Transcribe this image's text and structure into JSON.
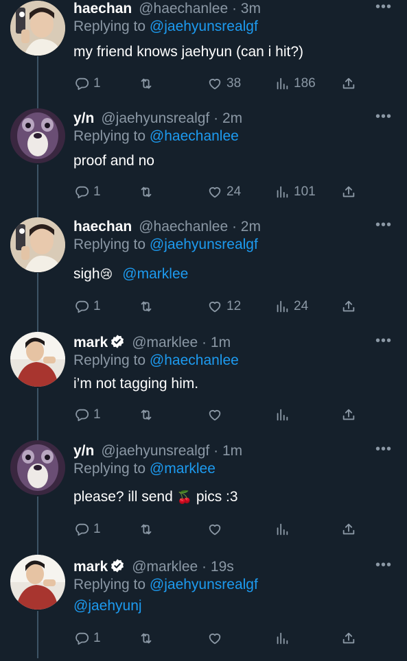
{
  "tweets": [
    {
      "name": "haechan",
      "verified": false,
      "handle": "@haechanlee",
      "time": "3m",
      "replying_prefix": "Replying to",
      "replying_to": "@jaehyunsrealgf",
      "text": "my friend knows jaehyun (can i hit?)",
      "mention": "",
      "emoji": "",
      "text_after": "",
      "replies": "1",
      "retweets": "",
      "likes": "38",
      "views": "186",
      "avatar": "haechan-selfie"
    },
    {
      "name": "y/n",
      "verified": false,
      "handle": "@jaehyunsrealgf",
      "time": "2m",
      "replying_prefix": "Replying to",
      "replying_to": "@haechanlee",
      "text": "proof and no",
      "mention": "",
      "emoji": "",
      "text_after": "",
      "replies": "1",
      "retweets": "",
      "likes": "24",
      "views": "101",
      "avatar": "purple-creature"
    },
    {
      "name": "haechan",
      "verified": false,
      "handle": "@haechanlee",
      "time": "2m",
      "replying_prefix": "Replying to",
      "replying_to": "@jaehyunsrealgf",
      "text": "sigh",
      "mention": "@marklee",
      "emoji": "😢",
      "text_after": "",
      "replies": "1",
      "retweets": "",
      "likes": "12",
      "views": "24",
      "avatar": "haechan-selfie"
    },
    {
      "name": "mark",
      "verified": true,
      "handle": "@marklee",
      "time": "1m",
      "replying_prefix": "Replying to",
      "replying_to": "@haechanlee",
      "text": "i’m not tagging him.",
      "mention": "",
      "emoji": "",
      "text_after": "",
      "replies": "1",
      "retweets": "",
      "likes": "",
      "views": "",
      "avatar": "mark-red-shirt"
    },
    {
      "name": "y/n",
      "verified": false,
      "handle": "@jaehyunsrealgf",
      "time": "1m",
      "replying_prefix": "Replying to",
      "replying_to": "@marklee",
      "text": "please? ill send ",
      "mention": "",
      "emoji": "🍒",
      "text_after": " pics :3",
      "replies": "1",
      "retweets": "",
      "likes": "",
      "views": "",
      "avatar": "purple-creature"
    },
    {
      "name": "mark",
      "verified": true,
      "handle": "@marklee",
      "time": "19s",
      "replying_prefix": "Replying to",
      "replying_to": "@jaehyunsrealgf",
      "text": "",
      "mention": "@jaehyunj",
      "emoji": "",
      "text_after": "",
      "replies": "1",
      "retweets": "",
      "likes": "",
      "views": "",
      "avatar": "mark-red-shirt"
    }
  ],
  "icons": {
    "reply": "reply-icon",
    "retweet": "retweet-icon",
    "like": "heart-icon",
    "views": "views-icon",
    "share": "share-icon",
    "more": "more-icon",
    "verified": "verified-badge-icon"
  },
  "colors": {
    "background": "#15202b",
    "link": "#1d9bf0",
    "muted": "#8b98a5",
    "thread": "#3d5466"
  }
}
